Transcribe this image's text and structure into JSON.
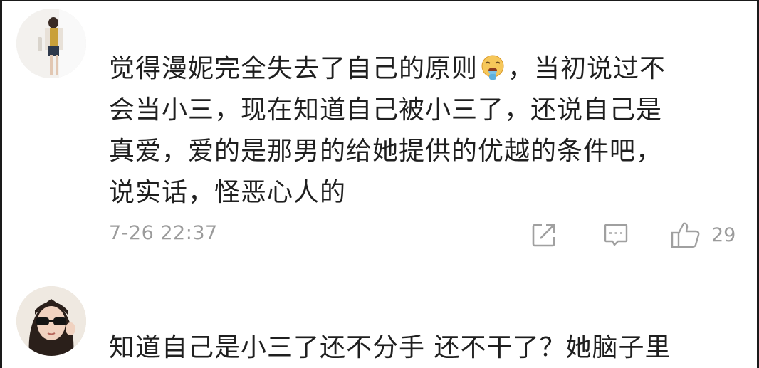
{
  "comments": [
    {
      "text_line1_before_emoji": "觉得漫妮完全失去了自己的原则",
      "emoji": "vomiting-face-emoji",
      "text_line1_after_emoji": "，当初说过不",
      "text_line2": "会当小三，现在知道自己被小三了，还说自己是",
      "text_line3": "真爱，爱的是那男的给她提供的优越的条件吧，",
      "text_line4": "说实话，怪恶心人的",
      "timestamp": "7-26 22:37",
      "like_count": "29"
    },
    {
      "text_line1": "知道自己是小三了还不分手 还不干了？她脑子里"
    }
  ],
  "colors": {
    "text": "#1f1f1f",
    "meta": "#9b9b9b",
    "icon": "#a0a0a0",
    "divider": "#e6e6e6"
  }
}
